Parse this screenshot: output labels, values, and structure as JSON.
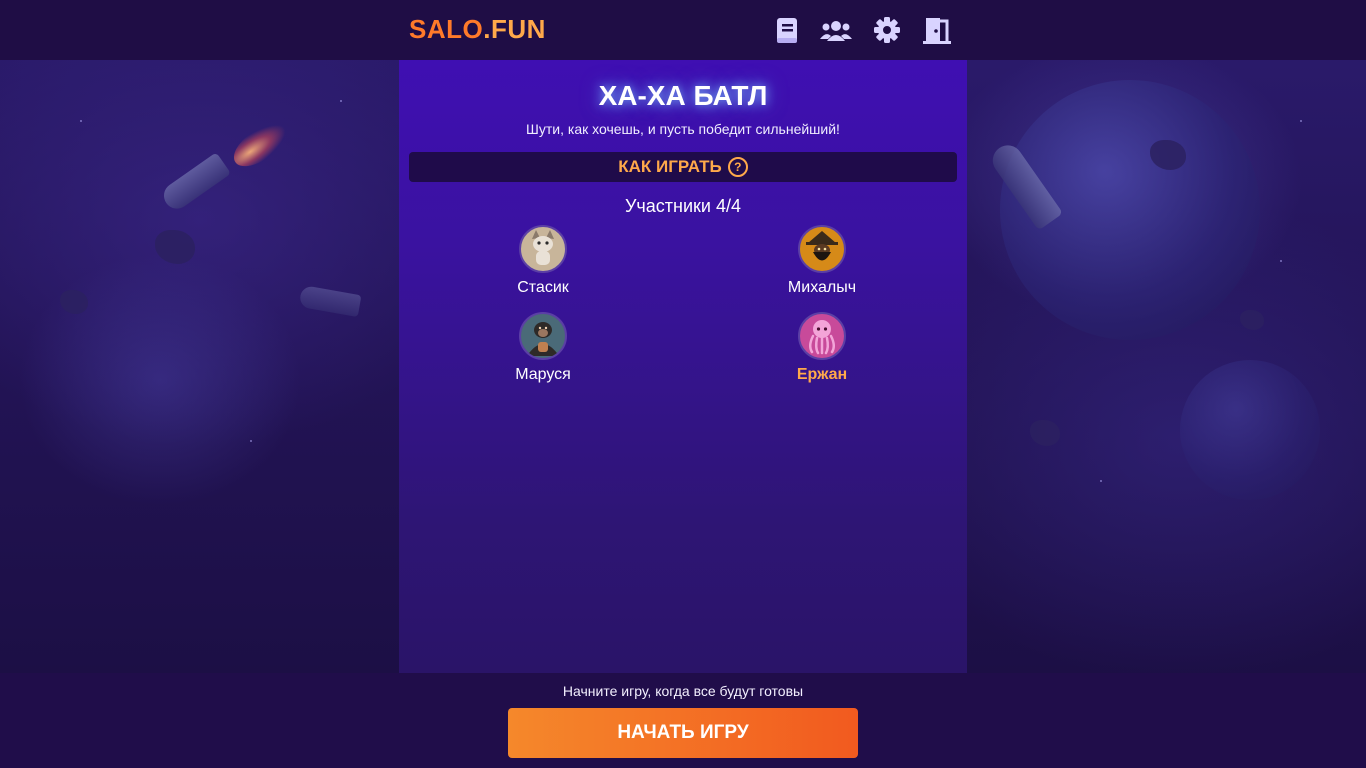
{
  "header": {
    "logo_part1": "SALO",
    "logo_part2": ".FUN",
    "icons": [
      "book-icon",
      "users-icon",
      "gear-icon",
      "exit-door-icon"
    ]
  },
  "game": {
    "title": "ХА-ХА БАТЛ",
    "subtitle": "Шути, как хочешь, и пусть победит сильнейший!",
    "how_to_play": "КАК ИГРАТЬ",
    "participants_label": "Участники 4/4"
  },
  "players": [
    {
      "name": "Стасик",
      "avatar": "cat-avatar",
      "is_me": false
    },
    {
      "name": "Михалыч",
      "avatar": "wizard-avatar",
      "is_me": false
    },
    {
      "name": "Маруся",
      "avatar": "gorilla-avatar",
      "is_me": false
    },
    {
      "name": "Ержан",
      "avatar": "octopus-avatar",
      "is_me": true
    }
  ],
  "footer": {
    "hint": "Начните игру, когда все будут готовы",
    "start_button": "НАЧАТЬ ИГРУ"
  },
  "colors": {
    "accent": "#ffa94a",
    "button_start": "#f5882b",
    "button_end": "#f25a1f",
    "panel": "#3f0fb2",
    "header": "#1f0d45"
  }
}
